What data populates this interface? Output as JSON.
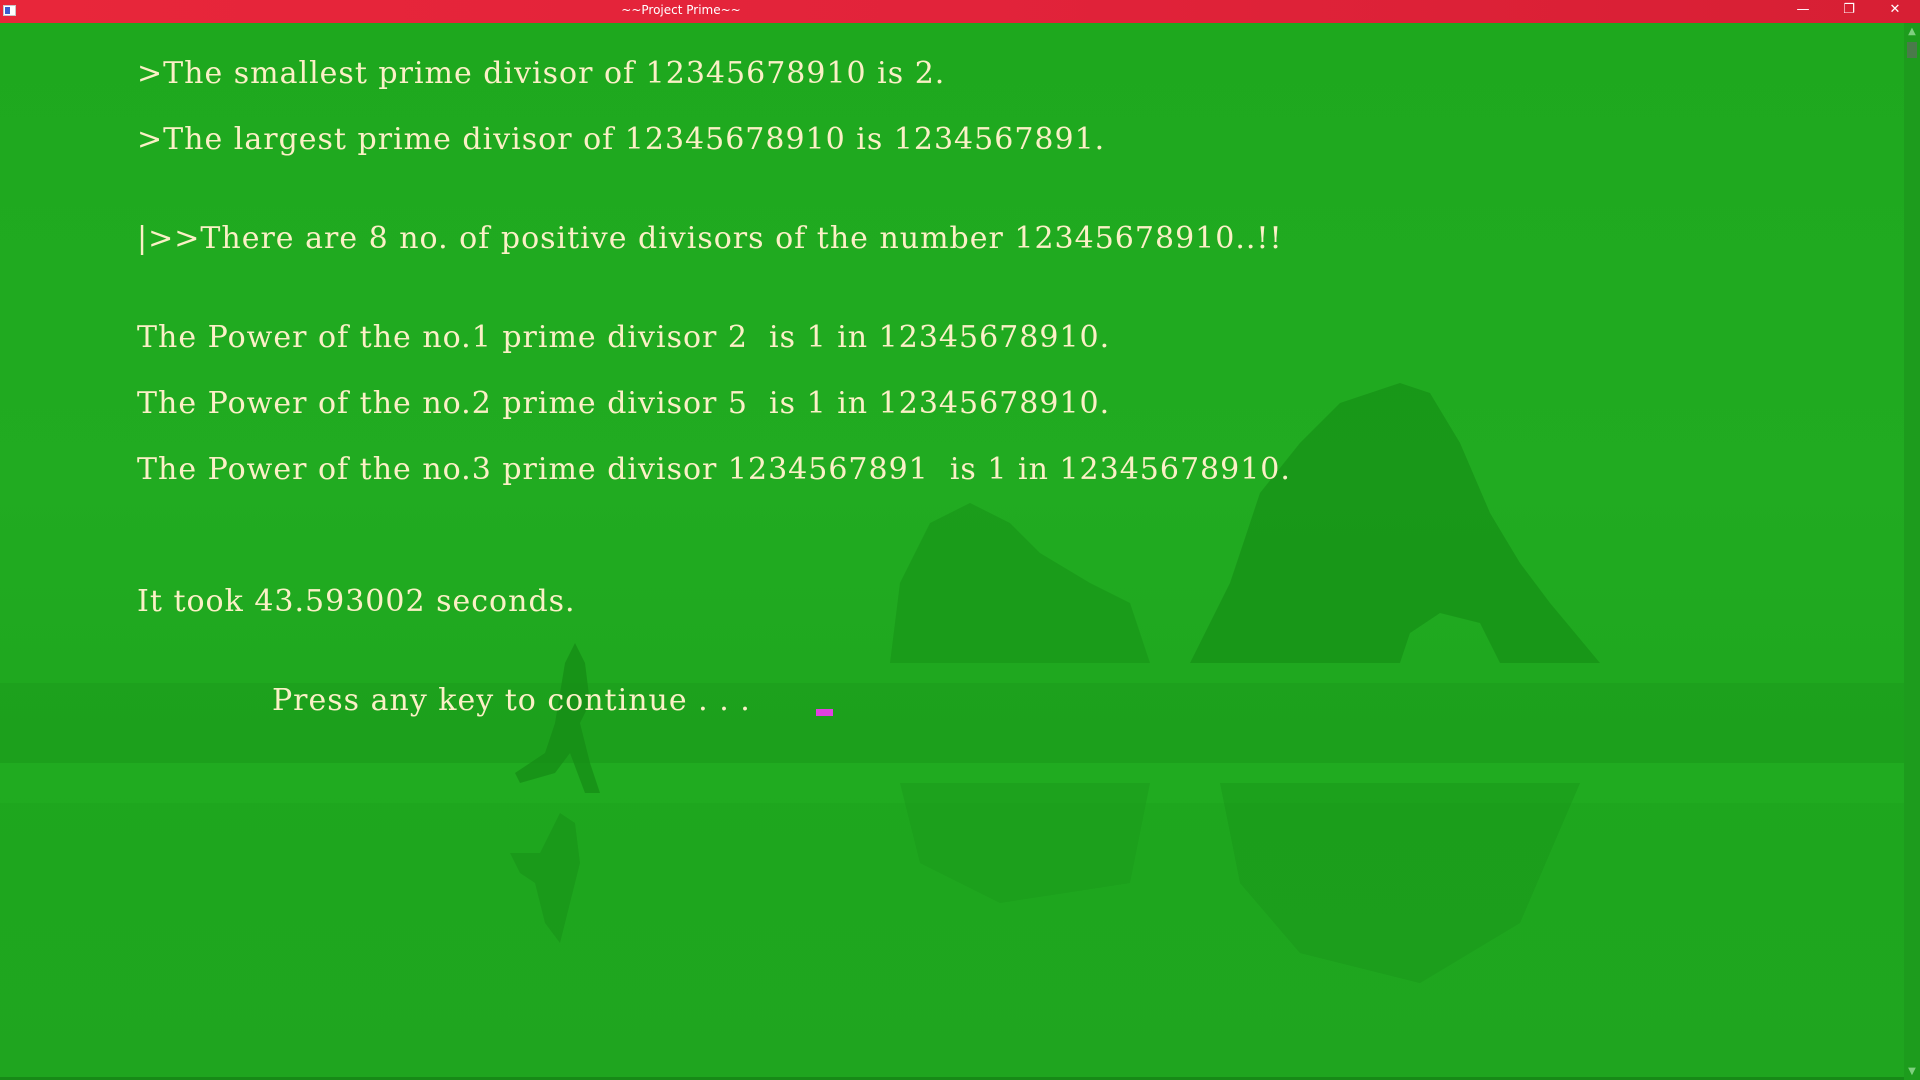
{
  "window": {
    "title": "~~Project Prime~~",
    "minimize_icon": "—",
    "restore_icon": "❐",
    "close_icon": "✕",
    "titlebar_color": "#e2233a",
    "background_color": "#1fa51f",
    "text_color": "#fbf0c6",
    "cursor_color": "#e040e0"
  },
  "console": {
    "lines": [
      ">The smallest prime divisor of 12345678910 is 2.",
      ">The largest prime divisor of 12345678910 is 1234567891.",
      "|>>There are 8 no. of positive divisors of the number 12345678910..!!",
      "The Power of the no.1 prime divisor 2  is 1 in 12345678910.",
      "The Power of the no.2 prime divisor 5  is 1 in 12345678910.",
      "The Power of the no.3 prime divisor 1234567891  is 1 in 12345678910.",
      "It took 43.593002 seconds.",
      "Press any key to continue . . ."
    ]
  },
  "scrollbar": {
    "up_icon": "▲",
    "down_icon": "▼"
  }
}
